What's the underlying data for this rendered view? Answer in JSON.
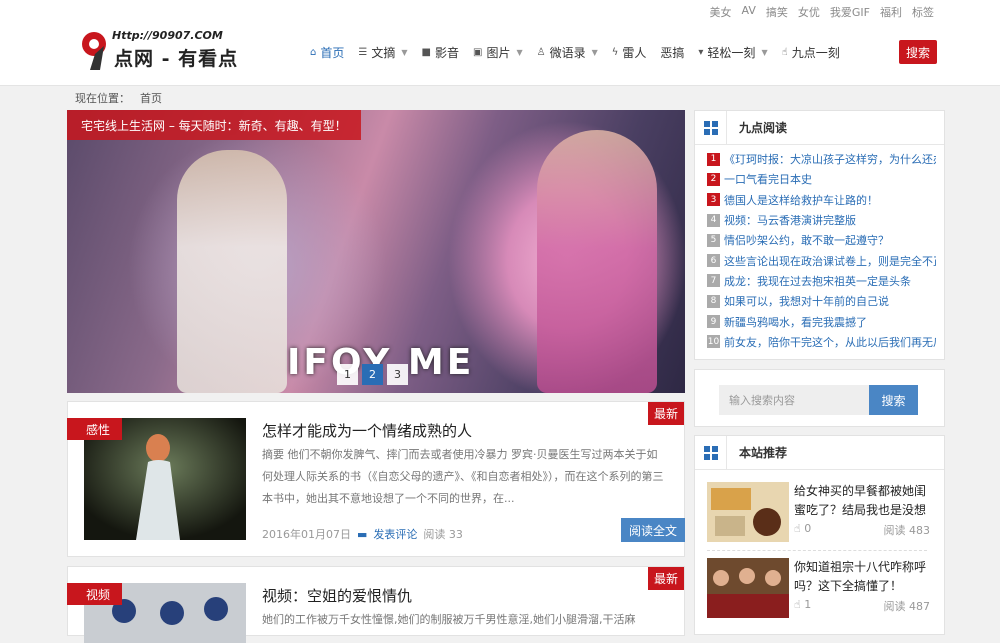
{
  "toplinks": [
    "美女",
    "AV",
    "搞笑",
    "女优",
    "我爱GIF",
    "福利",
    "标签"
  ],
  "logo": {
    "url_text": "Http://90907.COM",
    "name": "点网 - 有看点"
  },
  "nav": [
    {
      "label": "首页",
      "icon": "home-icon",
      "glyph": "⌂",
      "active": true,
      "dropdown": false
    },
    {
      "label": "文摘",
      "icon": "list-icon",
      "glyph": "☰",
      "active": false,
      "dropdown": true
    },
    {
      "label": "影音",
      "icon": "video-icon",
      "glyph": "■",
      "active": false,
      "dropdown": false
    },
    {
      "label": "图片",
      "icon": "image-icon",
      "glyph": "▣",
      "active": false,
      "dropdown": true
    },
    {
      "label": "微语录",
      "icon": "user-icon",
      "glyph": "♙",
      "active": false,
      "dropdown": true
    },
    {
      "label": "雷人",
      "icon": "bolt-icon",
      "glyph": "ϟ",
      "active": false,
      "dropdown": false
    },
    {
      "label": "恶搞",
      "icon": "",
      "glyph": "",
      "active": false,
      "dropdown": false
    },
    {
      "label": "轻松一刻",
      "icon": "glass-icon",
      "glyph": "▾",
      "active": false,
      "dropdown": true
    },
    {
      "label": "九点一刻",
      "icon": "thumbs-up-icon",
      "glyph": "☝",
      "active": false,
      "dropdown": false
    }
  ],
  "search_button": "搜索",
  "breadcrumb": {
    "prefix": "现在位置：",
    "current": "首页"
  },
  "slider": {
    "caption": "宅宅线上生活网 – 每天随时：新奇、有趣、有型！",
    "brand": "IFOY ME",
    "pages": [
      "1",
      "2",
      "3"
    ],
    "active_page": 2
  },
  "articles": [
    {
      "category": "感性",
      "badge": "最新",
      "title": "怎样才能成为一个情绪成熟的人",
      "summary": "摘要 他们不朝你发脾气、摔门而去或者使用冷暴力 罗宾·贝曼医生写过两本关于如何处理人际关系的书（《自恋父母的遗产》、《和自恋者相处》），而在这个系列的第三本书中，她出其不意地设想了一个不同的世界，在...",
      "date": "2016年01月07日",
      "comment": "发表评论",
      "reads": "阅读 33",
      "read_btn": "阅读全文"
    },
    {
      "category": "视频",
      "badge": "最新",
      "title": "视频：空姐的爱恨情仇",
      "summary": "她们的工作被万千女性憧憬,她们的制服被万千男性意淫,她们小腿滑溜,干活麻"
    }
  ],
  "ranking": {
    "title": "九点阅读",
    "items": [
      "《玎珂时报：大凉山孩子这样穷，为什么还办奥",
      "一口气看完日本史",
      "德国人是这样给救护车让路的！",
      "视频：马云香港演讲完整版",
      "情侣吵架公约，敢不敢一起遵守？",
      "这些言论出现在政治课试卷上，则是完全不正常",
      "成龙：我现在过去抱宋祖英一定是头条",
      "如果可以，我想对十年前的自己说",
      "新疆鸟鸦喝水，看完我震撼了",
      "前女友，陪你干完这个，从此以后我们再无瓜葛"
    ]
  },
  "site_search": {
    "placeholder": "输入搜索内容",
    "button": "搜索"
  },
  "recommend": {
    "title": "本站推荐",
    "items": [
      {
        "title": "给女神买的早餐都被她闺蜜吃了？结局我也是没想",
        "likes": "0",
        "reads": "阅读 483"
      },
      {
        "title": "你知道祖宗十八代咋称呼吗？这下全搞懂了！",
        "likes": "1",
        "reads": "阅读 487"
      }
    ]
  },
  "colors": {
    "accent": "#c8161d",
    "link": "#2a6db5",
    "button_blue": "#4a86c5"
  }
}
